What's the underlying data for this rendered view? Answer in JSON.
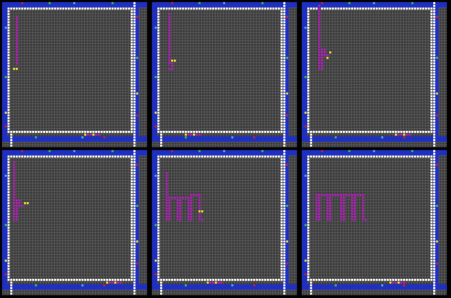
{
  "colors": {
    "background": "#000000",
    "cell": "#3a3a3a",
    "grid_line": "#5a5a5a",
    "wall_blue": "#1f2fbf",
    "wall_white": "#ffffff",
    "trail_magenta": "#b020b8",
    "marker_yellow": "#f0e040",
    "marker_red": "#d02020",
    "marker_green": "#40c040",
    "marker_cyan": "#50b0d0"
  },
  "grid": {
    "columns": 53,
    "rows": 53
  },
  "frames": [
    {
      "id": 1,
      "trail": [
        [
          5,
          5
        ],
        [
          5,
          22
        ]
      ],
      "tracer": [
        4,
        24
      ],
      "cursor_markers": [
        [
          4,
          24
        ],
        [
          5,
          24
        ]
      ]
    },
    {
      "id": 2,
      "trail": [
        [
          6,
          4
        ],
        [
          6,
          22
        ],
        [
          7,
          22
        ],
        [
          7,
          24
        ],
        [
          6,
          24
        ]
      ],
      "tracer": [
        7,
        21
      ],
      "cursor_markers": [
        [
          7,
          21
        ],
        [
          8,
          21
        ]
      ]
    },
    {
      "id": 3,
      "trail": [
        [
          6,
          1
        ],
        [
          6,
          24
        ],
        [
          7,
          24
        ],
        [
          7,
          17
        ],
        [
          8,
          17
        ],
        [
          8,
          19
        ],
        [
          9,
          19
        ]
      ],
      "tracer": [
        9,
        20
      ],
      "cursor_markers": [
        [
          9,
          20
        ],
        [
          10,
          18
        ]
      ]
    },
    {
      "id": 4,
      "trail": [
        [
          4,
          4
        ],
        [
          4,
          25
        ],
        [
          5,
          25
        ],
        [
          5,
          18
        ],
        [
          6,
          18
        ],
        [
          6,
          20
        ],
        [
          7,
          20
        ]
      ],
      "tracer": [
        8,
        19
      ],
      "cursor_markers": [
        [
          8,
          19
        ],
        [
          9,
          19
        ]
      ]
    },
    {
      "id": 5,
      "trail": [
        [
          5,
          8
        ],
        [
          5,
          25
        ],
        [
          6,
          25
        ],
        [
          6,
          17
        ],
        [
          9,
          17
        ],
        [
          9,
          25
        ],
        [
          10,
          25
        ],
        [
          10,
          17
        ],
        [
          13,
          17
        ],
        [
          13,
          25
        ],
        [
          14,
          25
        ],
        [
          14,
          16
        ],
        [
          17,
          16
        ],
        [
          17,
          25
        ],
        [
          18,
          25
        ]
      ],
      "tracer": [
        18,
        22
      ],
      "cursor_markers": [
        [
          18,
          22
        ],
        [
          17,
          22
        ]
      ]
    },
    {
      "id": 6,
      "trail": [
        [
          5,
          16
        ],
        [
          5,
          25
        ],
        [
          6,
          25
        ],
        [
          6,
          16
        ],
        [
          9,
          16
        ],
        [
          9,
          25
        ],
        [
          10,
          25
        ],
        [
          10,
          16
        ],
        [
          14,
          16
        ],
        [
          14,
          25
        ],
        [
          15,
          25
        ],
        [
          15,
          16
        ],
        [
          18,
          16
        ],
        [
          18,
          25
        ],
        [
          19,
          25
        ],
        [
          19,
          16
        ],
        [
          22,
          16
        ],
        [
          22,
          25
        ],
        [
          23,
          25
        ]
      ],
      "tracer": [
        23,
        25
      ],
      "cursor_markers": []
    }
  ]
}
